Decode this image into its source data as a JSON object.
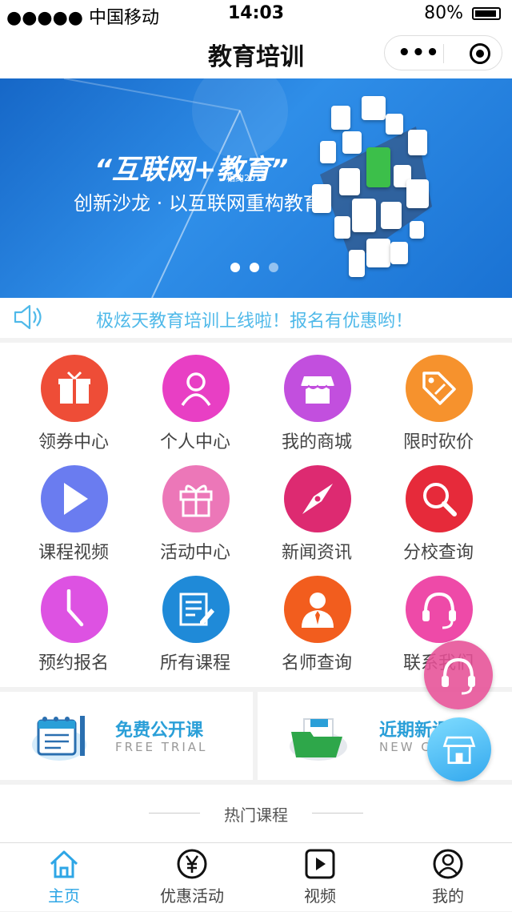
{
  "status_bar": {
    "carrier": "●●●●● 中国移动",
    "time": "14:03",
    "battery": "80%"
  },
  "nav": {
    "title": "教育培训",
    "more_icon": "more-dots-icon",
    "close_icon": "target-icon"
  },
  "banner": {
    "title": "“互联网+教育”",
    "tag": "相约2016",
    "subtitle": "创新沙龙 · 以互联网重构教育",
    "active_dot": 1,
    "dot_count": 3
  },
  "notice": {
    "text": "极炫天教育培训上线啦！报名有优惠哟！"
  },
  "grid": [
    {
      "label": "领券中心",
      "icon": "gift-box-icon",
      "color": "#ee4d37"
    },
    {
      "label": "个人中心",
      "icon": "person-icon",
      "color": "#e83fc4"
    },
    {
      "label": "我的商城",
      "icon": "shop-icon",
      "color": "#c24fde"
    },
    {
      "label": "限时砍价",
      "icon": "price-tag-icon",
      "color": "#f6922d"
    },
    {
      "label": "课程视频",
      "icon": "play-icon",
      "color": "#6a7cf0"
    },
    {
      "label": "活动中心",
      "icon": "gift-icon",
      "color": "#ec77b8"
    },
    {
      "label": "新闻资讯",
      "icon": "compass-icon",
      "color": "#dd2a71"
    },
    {
      "label": "分校查询",
      "icon": "search-icon",
      "color": "#e62a3a"
    },
    {
      "label": "预约报名",
      "icon": "clock-icon",
      "color": "#dd52e2"
    },
    {
      "label": "所有课程",
      "icon": "edit-doc-icon",
      "color": "#1f8ad8"
    },
    {
      "label": "名师查询",
      "icon": "teacher-icon",
      "color": "#f25d1e"
    },
    {
      "label": "联系我们",
      "icon": "headset-icon",
      "color": "#ee4aa8"
    }
  ],
  "promos": [
    {
      "title": "免费公开课",
      "subtitle": "FREE TRIAL"
    },
    {
      "title": "近期新课",
      "subtitle": "NEW COURSE"
    }
  ],
  "hot_section": {
    "title": "热门课程"
  },
  "tabbar": [
    {
      "label": "主页",
      "icon": "home-icon",
      "active": true
    },
    {
      "label": "优惠活动",
      "icon": "yen-icon",
      "active": false
    },
    {
      "label": "视频",
      "icon": "video-icon",
      "active": false
    },
    {
      "label": "我的",
      "icon": "user-icon",
      "active": false
    }
  ],
  "colors": {
    "accent": "#2ea6e6",
    "notice": "#4fb9e9",
    "banner": "#1f7ad8"
  }
}
